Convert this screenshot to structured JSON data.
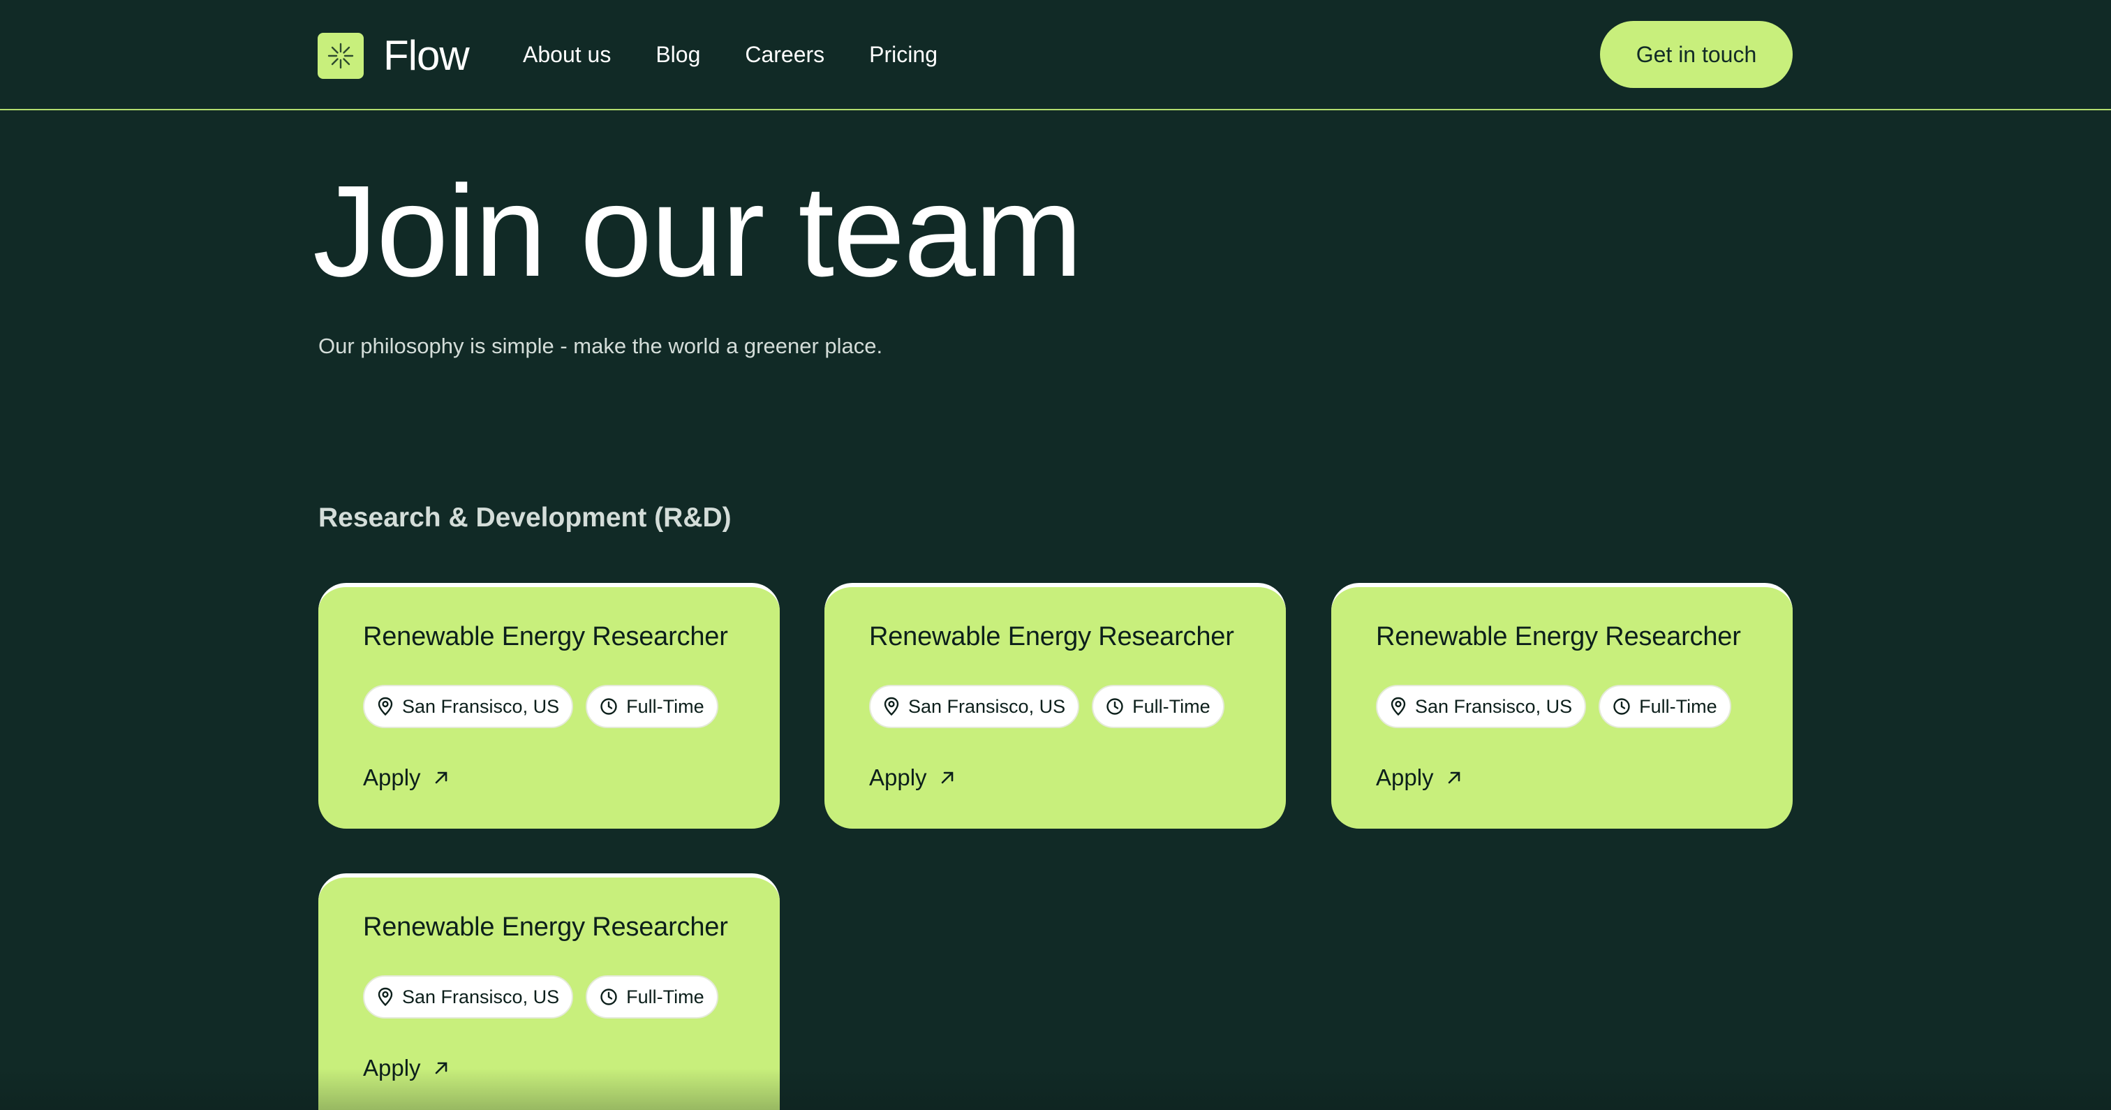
{
  "header": {
    "logo_text": "Flow",
    "logo_icon": "asterisk-sparkle-icon",
    "nav": [
      "About us",
      "Blog",
      "Careers",
      "Pricing"
    ],
    "cta_label": "Get in touch"
  },
  "hero": {
    "title": "Join our team",
    "subtitle": "Our philosophy is simple - make the world a greener place."
  },
  "section": {
    "title": "Research & Development (R&D)"
  },
  "jobs": [
    {
      "title": "Renewable Energy Researcher",
      "location": "San Fransisco, US",
      "type": "Full-Time",
      "apply": "Apply"
    },
    {
      "title": "Renewable Energy Researcher",
      "location": "San Fransisco, US",
      "type": "Full-Time",
      "apply": "Apply"
    },
    {
      "title": "Renewable Energy Researcher",
      "location": "San Fransisco, US",
      "type": "Full-Time",
      "apply": "Apply"
    },
    {
      "title": "Renewable Energy Researcher",
      "location": "San Fransisco, US",
      "type": "Full-Time",
      "apply": "Apply"
    }
  ],
  "colors": {
    "background": "#112a26",
    "accent": "#c8ef7c",
    "text_light": "#ffffff",
    "text_dark": "#0c1f1b"
  }
}
